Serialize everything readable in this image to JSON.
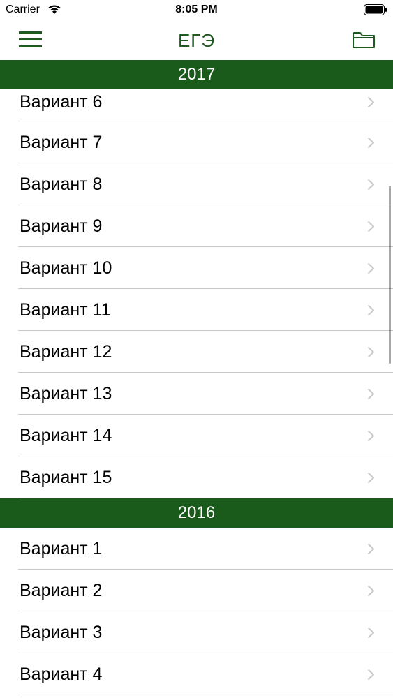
{
  "status_bar": {
    "carrier": "Carrier",
    "time": "8:05 PM",
    "icons": [
      "wifi-icon",
      "battery-icon"
    ]
  },
  "nav": {
    "title": "ЕГЭ",
    "left_icon": "menu-icon",
    "right_icon": "folder-icon"
  },
  "colors": {
    "accent": "#1e5a1e",
    "section_bg": "#1a5a1a",
    "separator": "#c8c7cc",
    "chevron": "#c7c7cc"
  },
  "sections": [
    {
      "year": "2017",
      "items": [
        "Вариант 6",
        "Вариант 7",
        "Вариант 8",
        "Вариант 9",
        "Вариант 10",
        "Вариант 11",
        "Вариант 12",
        "Вариант 13",
        "Вариант 14",
        "Вариант 15"
      ]
    },
    {
      "year": "2016",
      "items": [
        "Вариант 1",
        "Вариант 2",
        "Вариант 3",
        "Вариант 4"
      ]
    }
  ]
}
